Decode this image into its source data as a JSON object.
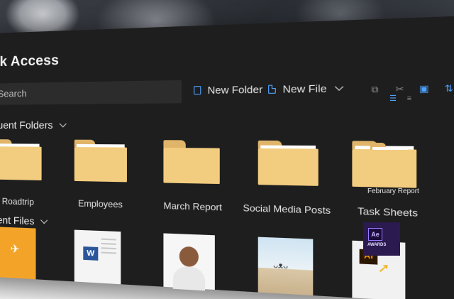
{
  "window": {
    "title": "ck Access",
    "controls": {
      "minimize": "–",
      "maximize": "□",
      "close": "✕"
    }
  },
  "search": {
    "placeholder": "Search"
  },
  "toolbar": {
    "new_folder_label": "New Folder",
    "new_file_label": "New File",
    "tools": [
      "copy-icon",
      "cut-icon",
      "paste-icon",
      "sort-icon",
      "list-view-icon",
      "details-view-icon"
    ]
  },
  "frequent": {
    "heading": "quent Folders",
    "folders": [
      {
        "label": "ka Roadtrip"
      },
      {
        "label": "Employees"
      },
      {
        "label": "March Report"
      },
      {
        "label": "Social Media Posts"
      },
      {
        "label": "Task Sheets"
      },
      {
        "label": "February Report"
      }
    ]
  },
  "recent": {
    "heading": "cent Files",
    "thumbs": [
      {
        "icon": "rocket-icon"
      },
      {
        "icon": "word-document-icon",
        "badge": "W"
      },
      {
        "icon": "portrait-photo-icon"
      },
      {
        "icon": "beach-photo-icon"
      },
      {
        "icon": "illustrator-icon",
        "badge": "Ai"
      },
      {
        "icon": "after-effects-icon",
        "badge": "Ae",
        "caption": "AWARDS"
      }
    ]
  },
  "colors": {
    "accent": "#4ea3ff",
    "folder": "#f3cd7f",
    "window_bg": "#1e1e1e"
  }
}
